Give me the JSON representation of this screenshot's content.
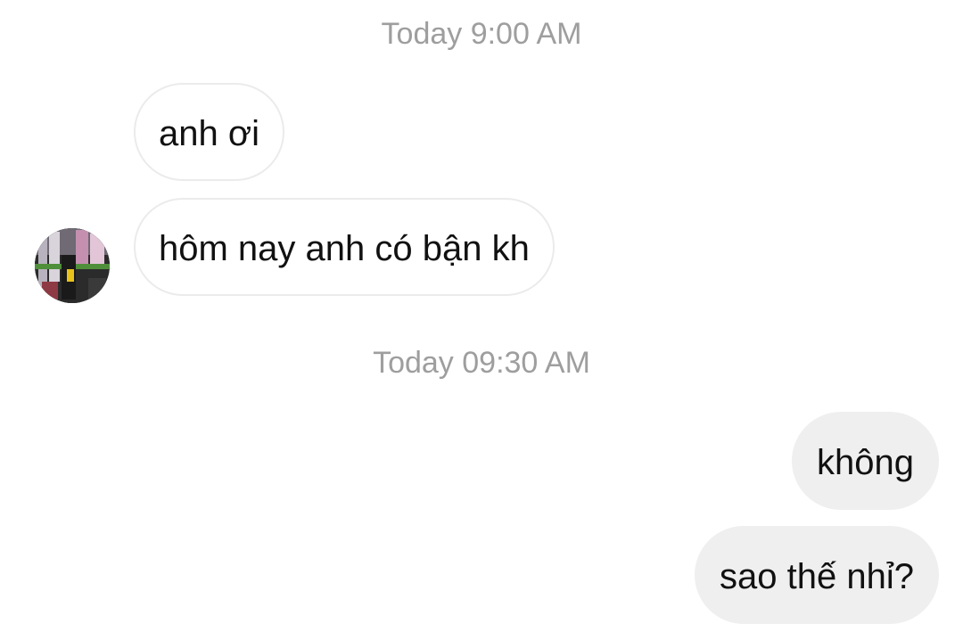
{
  "conversation": {
    "timestamps": [
      "Today 9:00 AM",
      "Today 09:30 AM"
    ],
    "incoming": [
      {
        "text": "anh ơi"
      },
      {
        "text": "hôm nay anh có bận kh"
      }
    ],
    "outgoing": [
      {
        "text": "không"
      },
      {
        "text": "sao thế nhỉ?"
      }
    ]
  },
  "colors": {
    "background": "#ffffff",
    "timestamp": "#9e9e9e",
    "incoming_border": "#ebebeb",
    "outgoing_bubble": "#efefef",
    "text": "#111111"
  }
}
